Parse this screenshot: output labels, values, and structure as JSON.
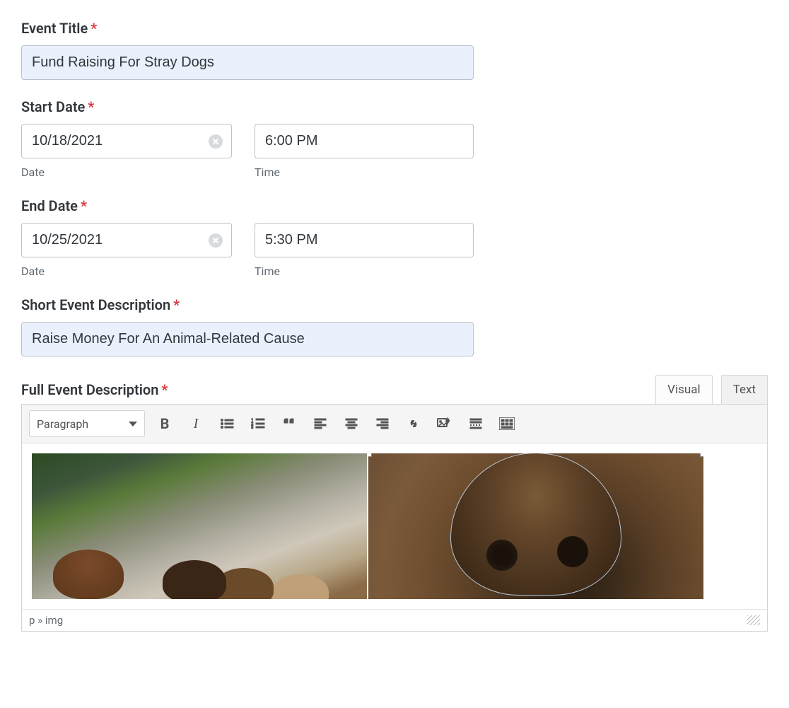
{
  "eventTitle": {
    "label": "Event Title",
    "value": "Fund Raising For Stray Dogs"
  },
  "startDate": {
    "label": "Start Date",
    "date_value": "10/18/2021",
    "time_value": "6:00 PM",
    "date_sublabel": "Date",
    "time_sublabel": "Time"
  },
  "endDate": {
    "label": "End Date",
    "date_value": "10/25/2021",
    "time_value": "5:30 PM",
    "date_sublabel": "Date",
    "time_sublabel": "Time"
  },
  "shortDesc": {
    "label": "Short Event Description",
    "value": "Raise Money For An Animal-Related Cause"
  },
  "fullDesc": {
    "label": "Full Event Description",
    "tabs": {
      "visual": "Visual",
      "text": "Text"
    },
    "format_selected": "Paragraph",
    "path_display": "p » img"
  }
}
